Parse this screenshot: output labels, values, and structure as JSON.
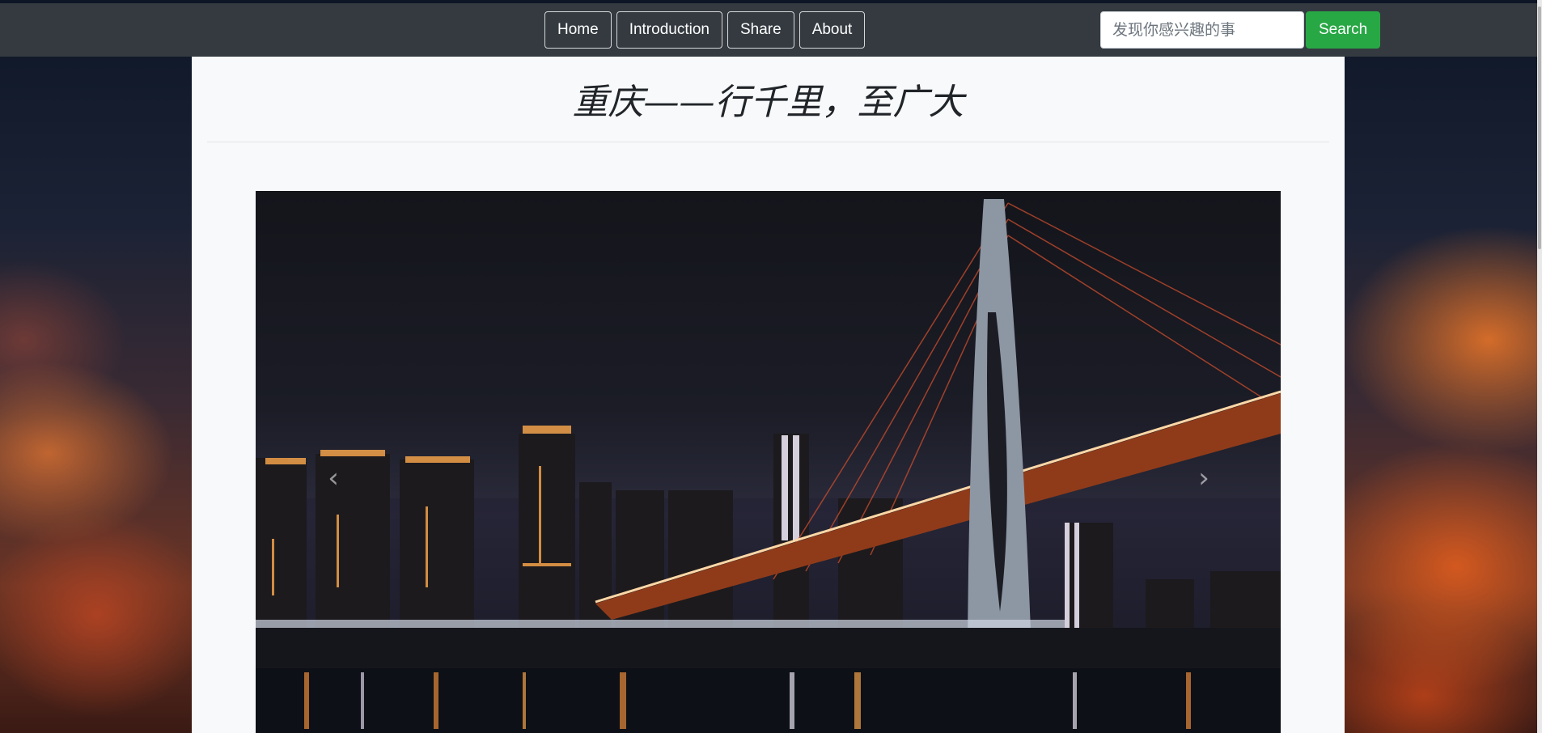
{
  "navbar": {
    "links": [
      {
        "label": "Home"
      },
      {
        "label": "Introduction"
      },
      {
        "label": "Share"
      },
      {
        "label": "About"
      }
    ],
    "search": {
      "placeholder": "发现你感兴趣的事",
      "button_label": "Search",
      "button_color": "#28a745"
    },
    "background_color": "#343a40"
  },
  "main": {
    "title": "重庆——行千里，至广大",
    "carousel": {
      "image_icon": "city-night-bridge-image",
      "prev_icon": "chevron-left-icon",
      "next_icon": "chevron-right-icon"
    }
  }
}
